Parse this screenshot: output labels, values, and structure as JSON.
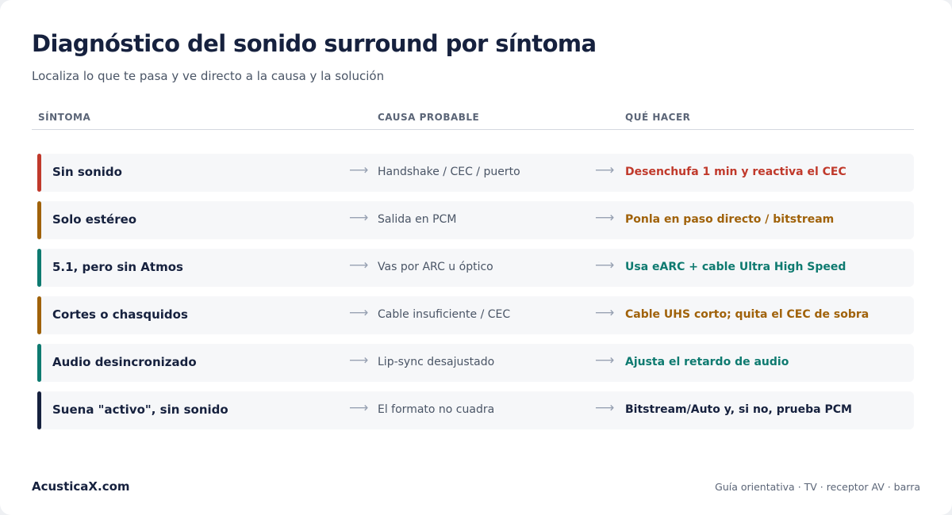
{
  "header": {
    "title": "Diagnóstico del sonido surround por síntoma",
    "subtitle": "Localiza lo que te pasa y ve directo a la causa y la solución"
  },
  "columns": {
    "symptom": "SÍNTOMA",
    "cause": "CAUSA PROBABLE",
    "action": "QUÉ HACER"
  },
  "arrow_glyph": "⟶",
  "colors": {
    "red": "#c0392b",
    "amber": "#a0620a",
    "teal": "#0e7a70",
    "navy": "#16213e"
  },
  "rows": [
    {
      "symptom": "Sin sonido",
      "cause": "Handshake / CEC / puerto",
      "action": "Desenchufa 1 min y reactiva el CEC",
      "color": "#c0392b"
    },
    {
      "symptom": "Solo estéreo",
      "cause": "Salida en PCM",
      "action": "Ponla en paso directo / bitstream",
      "color": "#a0620a"
    },
    {
      "symptom": "5.1, pero sin Atmos",
      "cause": "Vas por ARC u óptico",
      "action": "Usa eARC + cable Ultra High Speed",
      "color": "#0e7a70"
    },
    {
      "symptom": "Cortes o chasquidos",
      "cause": "Cable insuficiente / CEC",
      "action": "Cable UHS corto; quita el CEC de sobra",
      "color": "#a0620a"
    },
    {
      "symptom": "Audio desincronizado",
      "cause": "Lip-sync desajustado",
      "action": "Ajusta el retardo de audio",
      "color": "#0e7a70"
    },
    {
      "symptom": "Suena \"activo\", sin sonido",
      "cause": "El formato no cuadra",
      "action": "Bitstream/Auto y, si no, prueba PCM",
      "color": "#16213e"
    }
  ],
  "footer": {
    "brand": "AcusticaX.com",
    "note": "Guía orientativa · TV · receptor AV · barra"
  }
}
